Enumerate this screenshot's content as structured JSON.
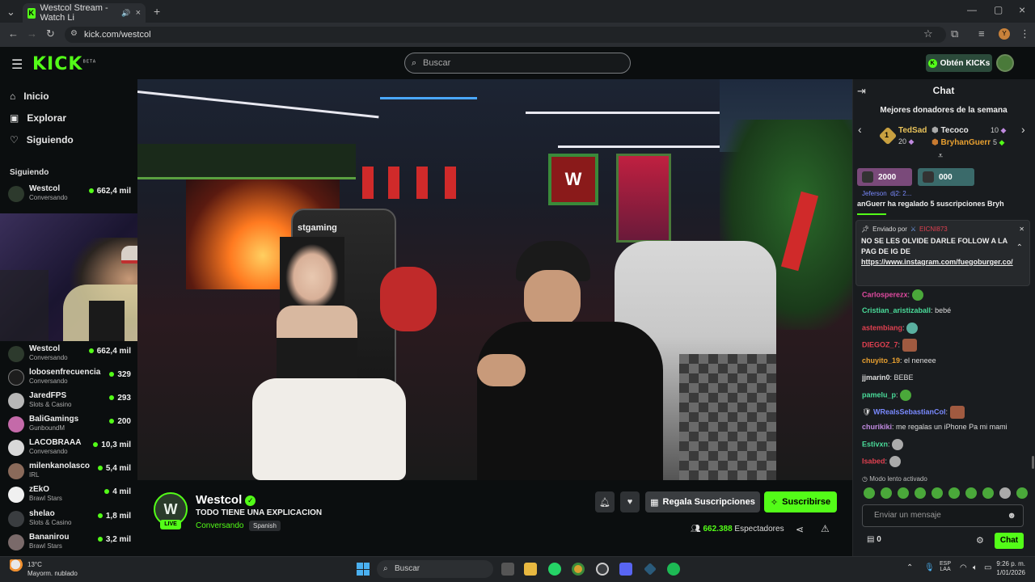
{
  "browser": {
    "tab_title": "Westcol Stream - Watch Li",
    "url": "kick.com/westcol"
  },
  "header": {
    "logo": "KICK",
    "logo_sup": "BETA",
    "search_placeholder": "Buscar",
    "kicks_button": "Obtén KICKs"
  },
  "sidebar": {
    "nav": [
      {
        "label": "Inicio",
        "icon": "home-icon"
      },
      {
        "label": "Explorar",
        "icon": "compass-icon"
      },
      {
        "label": "Siguiendo",
        "icon": "heart-icon"
      }
    ],
    "section_title": "Siguiendo",
    "top_channel": {
      "name": "Westcol",
      "category": "Conversando",
      "viewers": "662,4 mil"
    },
    "channels": [
      {
        "name": "Westcol",
        "category": "Conversando",
        "viewers": "662,4 mil",
        "color": "#2d3a2d"
      },
      {
        "name": "lobosenfrecuencia",
        "category": "Conversando",
        "viewers": "329",
        "color": "#1d1d1d"
      },
      {
        "name": "JaredFPS",
        "category": "Slots & Casino",
        "viewers": "293",
        "color": "#b7b7b7"
      },
      {
        "name": "BaliGamings",
        "category": "GunboundM",
        "viewers": "200",
        "color": "#c46aa9"
      },
      {
        "name": "LACOBRAAA",
        "category": "Conversando",
        "viewers": "10,3 mil",
        "color": "#d8d8d8"
      },
      {
        "name": "milenkanolasco",
        "category": "IRL",
        "viewers": "5,4 mil",
        "color": "#8a6a5a"
      },
      {
        "name": "zEkO",
        "category": "Brawl Stars",
        "viewers": "4 mil",
        "color": "#f0f0f0"
      },
      {
        "name": "shelao",
        "category": "Slots & Casino",
        "viewers": "1,8 mil",
        "color": "#3a3d40"
      },
      {
        "name": "Bananirou",
        "category": "Brawl Stars",
        "viewers": "3,2 mil",
        "color": "#7a6a6a"
      }
    ]
  },
  "stream": {
    "streamer": "Westcol",
    "live_label": "LIVE",
    "title": "TODO TIENE UNA EXPLICACION",
    "category": "Conversando",
    "language": "Spanish",
    "gift_button": "Regala Suscripciones",
    "subscribe_button": "Suscribirse",
    "viewers": "662.388",
    "viewers_label": "Espectadores",
    "video_brand": "stgaming"
  },
  "chat": {
    "title": "Chat",
    "donors_title": "Mejores donadores de la semana",
    "donors": [
      {
        "rank": "1",
        "name": "TedSad",
        "count": "20",
        "color": "#e8c25a"
      },
      {
        "name": "Tecoco",
        "count": "10",
        "color": "#e6e6e6"
      },
      {
        "name": "BryhanGuerr",
        "count": "5",
        "color": "#e8a030"
      }
    ],
    "pills": [
      {
        "value": "2000",
        "color": "#7a4a7a"
      },
      {
        "value": "000",
        "color": "#3a6a6a"
      }
    ],
    "ticker_top": "Jeferson_dj2: 2...",
    "ticker": "anGuerr ha regalado 5 suscripciones  Bryh",
    "pinned": {
      "header": "Enviado por",
      "sender": "EICNI873",
      "text": "NO SE LES OLVIDE DARLE FOLLOW A LA PAG DE IG DE",
      "link": "https://www.instagram.com/fuegoburger.co/"
    },
    "messages": [
      {
        "user": "Carlosperezx",
        "text": "",
        "color": "#e04aa0",
        "emote": "emote"
      },
      {
        "user": "Cristian_aristizaball",
        "text": "bebé",
        "color": "#4adc9a",
        "emote": ""
      },
      {
        "user": "astembiang",
        "text": "",
        "color": "#e04050",
        "emote": "emote"
      },
      {
        "user": "DIEGOZ_7",
        "text": "",
        "color": "#e04050",
        "emote": "img"
      },
      {
        "user": "chuyito_19",
        "text": "el neneee",
        "color": "#e8a030",
        "emote": ""
      },
      {
        "user": "jjmarin0",
        "text": "BEBE",
        "color": "#dddddd",
        "emote": ""
      },
      {
        "user": "pamelu_p",
        "text": "",
        "color": "#4adc9a",
        "emote": "emote"
      },
      {
        "user": "WRealsSebastianCol",
        "text": "",
        "color": "#7a8aff",
        "emote": "img"
      },
      {
        "user": "churikiki",
        "text": "me regalas un iPhone Pa mi mami",
        "color": "#c08ae0",
        "emote": ""
      },
      {
        "user": "Estivxn",
        "text": "",
        "color": "#4adc9a",
        "emote": "emote"
      },
      {
        "user": "Isabed",
        "text": "",
        "color": "#e04050",
        "emote": "emote"
      }
    ],
    "slow_mode": "Modo lento activado",
    "input_placeholder": "Enviar un mensaje",
    "kicks_count": "0",
    "send_button": "Chat"
  },
  "taskbar": {
    "weather_temp": "13°C",
    "weather_desc": "Mayorm. nublado",
    "search": "Buscar",
    "lang_top": "ESP",
    "lang_bottom": "LAA",
    "time": "9:26 p. m.",
    "date": "1/01/2026"
  }
}
